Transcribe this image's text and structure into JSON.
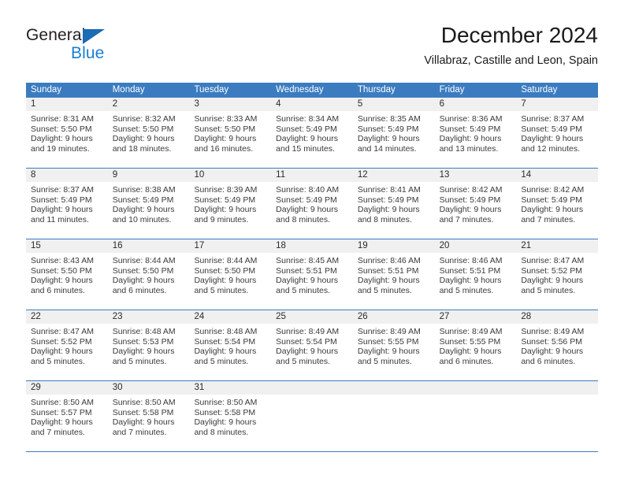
{
  "brand": {
    "name_top": "General",
    "name_bottom": "Blue",
    "triangle_icon": "triangle-logo-icon",
    "color_dark": "#231f20",
    "color_blue": "#1b7fd4",
    "color_triangle": "#1b6cb3"
  },
  "header": {
    "title": "December 2024",
    "subtitle": "Villabraz, Castille and Leon, Spain"
  },
  "theme": {
    "header_blue": "#3b7cc0",
    "daynum_band": "#f0f0f0",
    "text": "#1a1a1a"
  },
  "weekdays": [
    "Sunday",
    "Monday",
    "Tuesday",
    "Wednesday",
    "Thursday",
    "Friday",
    "Saturday"
  ],
  "weeks": [
    [
      {
        "day": "1",
        "sunrise": "Sunrise: 8:31 AM",
        "sunset": "Sunset: 5:50 PM",
        "daylight1": "Daylight: 9 hours",
        "daylight2": "and 19 minutes."
      },
      {
        "day": "2",
        "sunrise": "Sunrise: 8:32 AM",
        "sunset": "Sunset: 5:50 PM",
        "daylight1": "Daylight: 9 hours",
        "daylight2": "and 18 minutes."
      },
      {
        "day": "3",
        "sunrise": "Sunrise: 8:33 AM",
        "sunset": "Sunset: 5:50 PM",
        "daylight1": "Daylight: 9 hours",
        "daylight2": "and 16 minutes."
      },
      {
        "day": "4",
        "sunrise": "Sunrise: 8:34 AM",
        "sunset": "Sunset: 5:49 PM",
        "daylight1": "Daylight: 9 hours",
        "daylight2": "and 15 minutes."
      },
      {
        "day": "5",
        "sunrise": "Sunrise: 8:35 AM",
        "sunset": "Sunset: 5:49 PM",
        "daylight1": "Daylight: 9 hours",
        "daylight2": "and 14 minutes."
      },
      {
        "day": "6",
        "sunrise": "Sunrise: 8:36 AM",
        "sunset": "Sunset: 5:49 PM",
        "daylight1": "Daylight: 9 hours",
        "daylight2": "and 13 minutes."
      },
      {
        "day": "7",
        "sunrise": "Sunrise: 8:37 AM",
        "sunset": "Sunset: 5:49 PM",
        "daylight1": "Daylight: 9 hours",
        "daylight2": "and 12 minutes."
      }
    ],
    [
      {
        "day": "8",
        "sunrise": "Sunrise: 8:37 AM",
        "sunset": "Sunset: 5:49 PM",
        "daylight1": "Daylight: 9 hours",
        "daylight2": "and 11 minutes."
      },
      {
        "day": "9",
        "sunrise": "Sunrise: 8:38 AM",
        "sunset": "Sunset: 5:49 PM",
        "daylight1": "Daylight: 9 hours",
        "daylight2": "and 10 minutes."
      },
      {
        "day": "10",
        "sunrise": "Sunrise: 8:39 AM",
        "sunset": "Sunset: 5:49 PM",
        "daylight1": "Daylight: 9 hours",
        "daylight2": "and 9 minutes."
      },
      {
        "day": "11",
        "sunrise": "Sunrise: 8:40 AM",
        "sunset": "Sunset: 5:49 PM",
        "daylight1": "Daylight: 9 hours",
        "daylight2": "and 8 minutes."
      },
      {
        "day": "12",
        "sunrise": "Sunrise: 8:41 AM",
        "sunset": "Sunset: 5:49 PM",
        "daylight1": "Daylight: 9 hours",
        "daylight2": "and 8 minutes."
      },
      {
        "day": "13",
        "sunrise": "Sunrise: 8:42 AM",
        "sunset": "Sunset: 5:49 PM",
        "daylight1": "Daylight: 9 hours",
        "daylight2": "and 7 minutes."
      },
      {
        "day": "14",
        "sunrise": "Sunrise: 8:42 AM",
        "sunset": "Sunset: 5:49 PM",
        "daylight1": "Daylight: 9 hours",
        "daylight2": "and 7 minutes."
      }
    ],
    [
      {
        "day": "15",
        "sunrise": "Sunrise: 8:43 AM",
        "sunset": "Sunset: 5:50 PM",
        "daylight1": "Daylight: 9 hours",
        "daylight2": "and 6 minutes."
      },
      {
        "day": "16",
        "sunrise": "Sunrise: 8:44 AM",
        "sunset": "Sunset: 5:50 PM",
        "daylight1": "Daylight: 9 hours",
        "daylight2": "and 6 minutes."
      },
      {
        "day": "17",
        "sunrise": "Sunrise: 8:44 AM",
        "sunset": "Sunset: 5:50 PM",
        "daylight1": "Daylight: 9 hours",
        "daylight2": "and 5 minutes."
      },
      {
        "day": "18",
        "sunrise": "Sunrise: 8:45 AM",
        "sunset": "Sunset: 5:51 PM",
        "daylight1": "Daylight: 9 hours",
        "daylight2": "and 5 minutes."
      },
      {
        "day": "19",
        "sunrise": "Sunrise: 8:46 AM",
        "sunset": "Sunset: 5:51 PM",
        "daylight1": "Daylight: 9 hours",
        "daylight2": "and 5 minutes."
      },
      {
        "day": "20",
        "sunrise": "Sunrise: 8:46 AM",
        "sunset": "Sunset: 5:51 PM",
        "daylight1": "Daylight: 9 hours",
        "daylight2": "and 5 minutes."
      },
      {
        "day": "21",
        "sunrise": "Sunrise: 8:47 AM",
        "sunset": "Sunset: 5:52 PM",
        "daylight1": "Daylight: 9 hours",
        "daylight2": "and 5 minutes."
      }
    ],
    [
      {
        "day": "22",
        "sunrise": "Sunrise: 8:47 AM",
        "sunset": "Sunset: 5:52 PM",
        "daylight1": "Daylight: 9 hours",
        "daylight2": "and 5 minutes."
      },
      {
        "day": "23",
        "sunrise": "Sunrise: 8:48 AM",
        "sunset": "Sunset: 5:53 PM",
        "daylight1": "Daylight: 9 hours",
        "daylight2": "and 5 minutes."
      },
      {
        "day": "24",
        "sunrise": "Sunrise: 8:48 AM",
        "sunset": "Sunset: 5:54 PM",
        "daylight1": "Daylight: 9 hours",
        "daylight2": "and 5 minutes."
      },
      {
        "day": "25",
        "sunrise": "Sunrise: 8:49 AM",
        "sunset": "Sunset: 5:54 PM",
        "daylight1": "Daylight: 9 hours",
        "daylight2": "and 5 minutes."
      },
      {
        "day": "26",
        "sunrise": "Sunrise: 8:49 AM",
        "sunset": "Sunset: 5:55 PM",
        "daylight1": "Daylight: 9 hours",
        "daylight2": "and 5 minutes."
      },
      {
        "day": "27",
        "sunrise": "Sunrise: 8:49 AM",
        "sunset": "Sunset: 5:55 PM",
        "daylight1": "Daylight: 9 hours",
        "daylight2": "and 6 minutes."
      },
      {
        "day": "28",
        "sunrise": "Sunrise: 8:49 AM",
        "sunset": "Sunset: 5:56 PM",
        "daylight1": "Daylight: 9 hours",
        "daylight2": "and 6 minutes."
      }
    ],
    [
      {
        "day": "29",
        "sunrise": "Sunrise: 8:50 AM",
        "sunset": "Sunset: 5:57 PM",
        "daylight1": "Daylight: 9 hours",
        "daylight2": "and 7 minutes."
      },
      {
        "day": "30",
        "sunrise": "Sunrise: 8:50 AM",
        "sunset": "Sunset: 5:58 PM",
        "daylight1": "Daylight: 9 hours",
        "daylight2": "and 7 minutes."
      },
      {
        "day": "31",
        "sunrise": "Sunrise: 8:50 AM",
        "sunset": "Sunset: 5:58 PM",
        "daylight1": "Daylight: 9 hours",
        "daylight2": "and 8 minutes."
      },
      {
        "day": "",
        "sunrise": "",
        "sunset": "",
        "daylight1": "",
        "daylight2": ""
      },
      {
        "day": "",
        "sunrise": "",
        "sunset": "",
        "daylight1": "",
        "daylight2": ""
      },
      {
        "day": "",
        "sunrise": "",
        "sunset": "",
        "daylight1": "",
        "daylight2": ""
      },
      {
        "day": "",
        "sunrise": "",
        "sunset": "",
        "daylight1": "",
        "daylight2": ""
      }
    ]
  ]
}
